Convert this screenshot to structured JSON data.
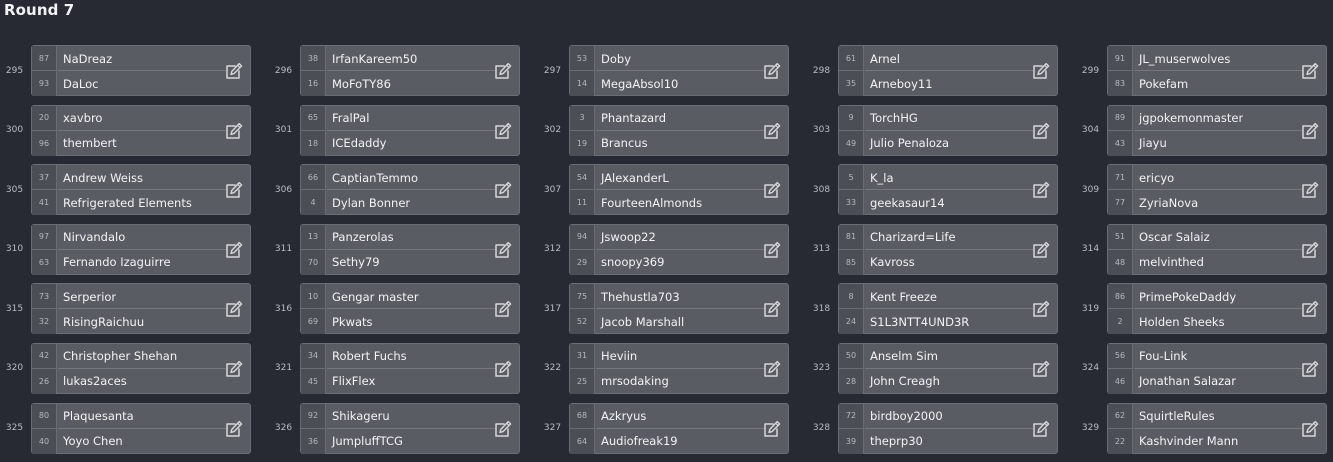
{
  "round": {
    "title": "Round 7"
  },
  "matches": [
    {
      "id": "295",
      "p1": {
        "seed": "87",
        "name": "NaDreaz"
      },
      "p2": {
        "seed": "93",
        "name": "DaLoc"
      }
    },
    {
      "id": "296",
      "p1": {
        "seed": "38",
        "name": "IrfanKareem50"
      },
      "p2": {
        "seed": "16",
        "name": "MoFoTY86"
      }
    },
    {
      "id": "297",
      "p1": {
        "seed": "53",
        "name": "Doby"
      },
      "p2": {
        "seed": "14",
        "name": "MegaAbsol10"
      }
    },
    {
      "id": "298",
      "p1": {
        "seed": "61",
        "name": "Arnel"
      },
      "p2": {
        "seed": "35",
        "name": "Arneboy11"
      }
    },
    {
      "id": "299",
      "p1": {
        "seed": "91",
        "name": "JL_muserwolves"
      },
      "p2": {
        "seed": "83",
        "name": "Pokefam"
      }
    },
    {
      "id": "300",
      "p1": {
        "seed": "20",
        "name": "xavbro"
      },
      "p2": {
        "seed": "96",
        "name": "thembert"
      }
    },
    {
      "id": "301",
      "p1": {
        "seed": "65",
        "name": "FralPal"
      },
      "p2": {
        "seed": "18",
        "name": "ICEdaddy"
      }
    },
    {
      "id": "302",
      "p1": {
        "seed": "3",
        "name": "Phantazard"
      },
      "p2": {
        "seed": "19",
        "name": "Brancus"
      }
    },
    {
      "id": "303",
      "p1": {
        "seed": "9",
        "name": "TorchHG"
      },
      "p2": {
        "seed": "49",
        "name": "Julio Penaloza"
      }
    },
    {
      "id": "304",
      "p1": {
        "seed": "89",
        "name": "jgpokemonmaster"
      },
      "p2": {
        "seed": "43",
        "name": "Jiayu"
      }
    },
    {
      "id": "305",
      "p1": {
        "seed": "37",
        "name": "Andrew Weiss"
      },
      "p2": {
        "seed": "41",
        "name": "Refrigerated Elements"
      }
    },
    {
      "id": "306",
      "p1": {
        "seed": "66",
        "name": "CaptianTemmo"
      },
      "p2": {
        "seed": "4",
        "name": "Dylan Bonner"
      }
    },
    {
      "id": "307",
      "p1": {
        "seed": "54",
        "name": "JAlexanderL"
      },
      "p2": {
        "seed": "11",
        "name": "FourteenAlmonds"
      }
    },
    {
      "id": "308",
      "p1": {
        "seed": "5",
        "name": "K_la"
      },
      "p2": {
        "seed": "33",
        "name": "geekasaur14"
      }
    },
    {
      "id": "309",
      "p1": {
        "seed": "71",
        "name": "ericyo"
      },
      "p2": {
        "seed": "77",
        "name": "ZyriaNova"
      }
    },
    {
      "id": "310",
      "p1": {
        "seed": "97",
        "name": "Nirvandalo"
      },
      "p2": {
        "seed": "63",
        "name": "Fernando Izaguirre"
      }
    },
    {
      "id": "311",
      "p1": {
        "seed": "13",
        "name": "Panzerolas"
      },
      "p2": {
        "seed": "70",
        "name": "Sethy79"
      }
    },
    {
      "id": "312",
      "p1": {
        "seed": "94",
        "name": "Jswoop22"
      },
      "p2": {
        "seed": "29",
        "name": "snoopy369"
      }
    },
    {
      "id": "313",
      "p1": {
        "seed": "81",
        "name": "Charizard=Life"
      },
      "p2": {
        "seed": "85",
        "name": "Kavross"
      }
    },
    {
      "id": "314",
      "p1": {
        "seed": "51",
        "name": "Oscar Salaiz"
      },
      "p2": {
        "seed": "48",
        "name": "melvinthed"
      }
    },
    {
      "id": "315",
      "p1": {
        "seed": "73",
        "name": "Serperior"
      },
      "p2": {
        "seed": "32",
        "name": "RisingRaichuu"
      }
    },
    {
      "id": "316",
      "p1": {
        "seed": "10",
        "name": "Gengar master"
      },
      "p2": {
        "seed": "69",
        "name": "Pkwats"
      }
    },
    {
      "id": "317",
      "p1": {
        "seed": "75",
        "name": "Thehustla703"
      },
      "p2": {
        "seed": "52",
        "name": "Jacob Marshall"
      }
    },
    {
      "id": "318",
      "p1": {
        "seed": "8",
        "name": "Kent Freeze"
      },
      "p2": {
        "seed": "24",
        "name": "S1L3NTT4UND3R"
      }
    },
    {
      "id": "319",
      "p1": {
        "seed": "86",
        "name": "PrimePokeDaddy"
      },
      "p2": {
        "seed": "2",
        "name": "Holden Sheeks"
      }
    },
    {
      "id": "320",
      "p1": {
        "seed": "42",
        "name": "Christopher Shehan"
      },
      "p2": {
        "seed": "26",
        "name": "lukas2aces"
      }
    },
    {
      "id": "321",
      "p1": {
        "seed": "34",
        "name": "Robert Fuchs"
      },
      "p2": {
        "seed": "45",
        "name": "FlixFlex"
      }
    },
    {
      "id": "322",
      "p1": {
        "seed": "31",
        "name": "Heviin"
      },
      "p2": {
        "seed": "25",
        "name": "mrsodaking"
      }
    },
    {
      "id": "323",
      "p1": {
        "seed": "50",
        "name": "Anselm Sim"
      },
      "p2": {
        "seed": "28",
        "name": "John Creagh"
      }
    },
    {
      "id": "324",
      "p1": {
        "seed": "56",
        "name": "Fou-Link"
      },
      "p2": {
        "seed": "46",
        "name": "Jonathan Salazar"
      }
    },
    {
      "id": "325",
      "p1": {
        "seed": "80",
        "name": "Plaquesanta"
      },
      "p2": {
        "seed": "40",
        "name": "Yoyo Chen"
      }
    },
    {
      "id": "326",
      "p1": {
        "seed": "92",
        "name": "Shikageru"
      },
      "p2": {
        "seed": "36",
        "name": "JumpluffTCG"
      }
    },
    {
      "id": "327",
      "p1": {
        "seed": "68",
        "name": "Azkryus"
      },
      "p2": {
        "seed": "64",
        "name": "Audiofreak19"
      }
    },
    {
      "id": "328",
      "p1": {
        "seed": "72",
        "name": "birdboy2000"
      },
      "p2": {
        "seed": "39",
        "name": "theprp30"
      }
    },
    {
      "id": "329",
      "p1": {
        "seed": "62",
        "name": "SquirtleRules"
      },
      "p2": {
        "seed": "22",
        "name": "Kashvinder Mann"
      }
    }
  ],
  "icons": {
    "edit": "edit-icon"
  },
  "colors": {
    "background": "#272a33",
    "card": "#5a5c63",
    "seed_box": "#4c4e55"
  }
}
